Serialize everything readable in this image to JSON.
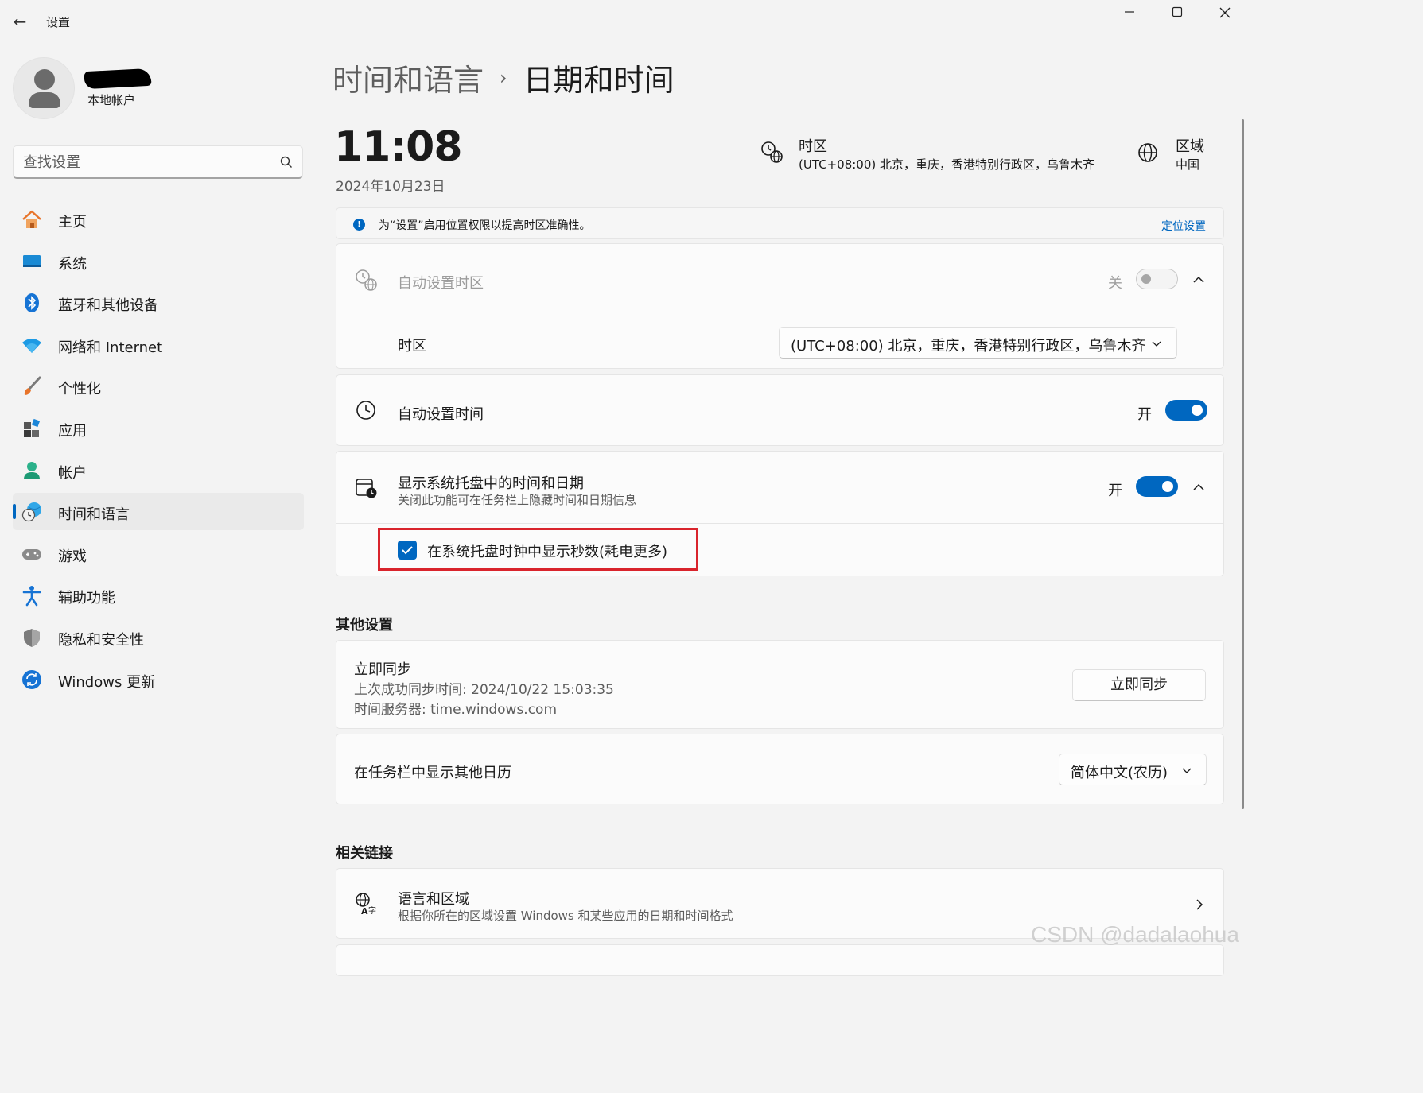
{
  "window": {
    "title": "设置",
    "back_icon": "←",
    "minimize_icon": "—",
    "maximize_icon": "☐",
    "close_icon": "✕"
  },
  "account": {
    "type": "本地帐户"
  },
  "search": {
    "placeholder": "查找设置"
  },
  "sidebar": {
    "items": [
      {
        "label": "主页",
        "icon": "home-icon"
      },
      {
        "label": "系统",
        "icon": "system-icon"
      },
      {
        "label": "蓝牙和其他设备",
        "icon": "bluetooth-icon"
      },
      {
        "label": "网络和 Internet",
        "icon": "wifi-icon"
      },
      {
        "label": "个性化",
        "icon": "brush-icon"
      },
      {
        "label": "应用",
        "icon": "apps-icon"
      },
      {
        "label": "帐户",
        "icon": "account-icon"
      },
      {
        "label": "时间和语言",
        "icon": "time-language-icon",
        "active": true
      },
      {
        "label": "游戏",
        "icon": "gamepad-icon"
      },
      {
        "label": "辅助功能",
        "icon": "accessibility-icon"
      },
      {
        "label": "隐私和安全性",
        "icon": "shield-icon"
      },
      {
        "label": "Windows 更新",
        "icon": "update-icon"
      }
    ]
  },
  "breadcrumb": {
    "parent": "时间和语言",
    "separator": "›",
    "current": "日期和时间"
  },
  "header": {
    "time": "11:08",
    "date": "2024年10月23日",
    "timezone_label": "时区",
    "timezone_value": "(UTC+08:00) 北京，重庆，香港特别行政区，乌鲁木齐",
    "region_label": "区域",
    "region_value": "中国"
  },
  "info_bar": {
    "text": "为“设置”启用位置权限以提高时区准确性。",
    "link": "定位设置"
  },
  "auto_timezone": {
    "title": "自动设置时区",
    "state_label": "关",
    "enabled": false,
    "timezone_row_label": "时区",
    "timezone_selected": "(UTC+08:00) 北京，重庆，香港特别行政区，乌鲁木齐"
  },
  "auto_time": {
    "title": "自动设置时间",
    "state_label": "开",
    "enabled": true
  },
  "tray_time": {
    "title": "显示系统托盘中的时间和日期",
    "subtitle": "关闭此功能可在任务栏上隐藏时间和日期信息",
    "state_label": "开",
    "enabled": true,
    "seconds_checkbox_label": "在系统托盘时钟中显示秒数(耗电更多)",
    "seconds_checked": true
  },
  "other_settings": {
    "section_title": "其他设置",
    "sync_title": "立即同步",
    "sync_last": "上次成功同步时间: 2024/10/22 15:03:35",
    "sync_server": "时间服务器: time.windows.com",
    "sync_button": "立即同步",
    "calendar_label": "在任务栏中显示其他日历",
    "calendar_selected": "简体中文(农历)"
  },
  "related_links": {
    "section_title": "相关链接",
    "language_region_title": "语言和区域",
    "language_region_subtitle": "根据你所在的区域设置 Windows 和某些应用的日期和时间格式"
  },
  "watermark": "CSDN @dadalaohua",
  "colors": {
    "accent": "#0067c0",
    "highlight_border": "#d9242c",
    "background": "#f3f3f3",
    "card": "#fbfbfb"
  }
}
